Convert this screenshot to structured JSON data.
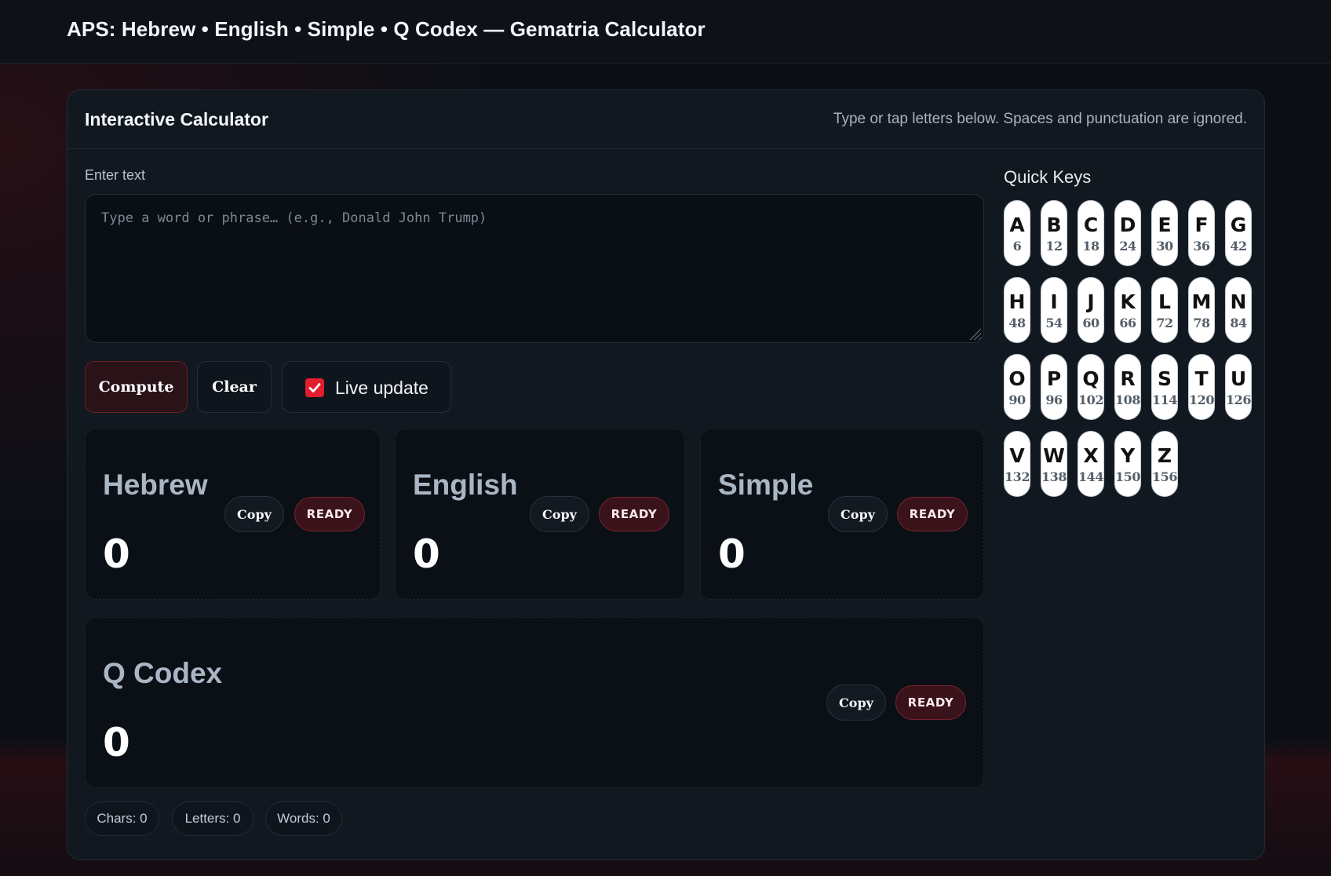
{
  "app": {
    "title": "APS: Hebrew • English • Simple • Q Codex — Gematria Calculator"
  },
  "calculator": {
    "title": "Interactive Calculator",
    "hint": "Type or tap letters below. Spaces and punctuation are ignored.",
    "input_label": "Enter text",
    "input_placeholder": "Type a word or phrase… (e.g., Donald John Trump)",
    "input_value": "",
    "compute_label": "Compute",
    "clear_label": "Clear",
    "live_update_label": "Live update",
    "live_update_checked": true
  },
  "results": {
    "hebrew": {
      "name": "Hebrew",
      "value": "0",
      "copy_label": "Copy",
      "status": "READY"
    },
    "english": {
      "name": "English",
      "value": "0",
      "copy_label": "Copy",
      "status": "READY"
    },
    "simple": {
      "name": "Simple",
      "value": "0",
      "copy_label": "Copy",
      "status": "READY"
    },
    "qcodex": {
      "name": "Q Codex",
      "value": "0",
      "copy_label": "Copy",
      "status": "READY"
    }
  },
  "stats": {
    "chars": "Chars: 0",
    "letters": "Letters: 0",
    "words": "Words: 0"
  },
  "quick_keys": {
    "title": "Quick Keys",
    "keys": [
      {
        "letter": "A",
        "value": "6"
      },
      {
        "letter": "B",
        "value": "12"
      },
      {
        "letter": "C",
        "value": "18"
      },
      {
        "letter": "D",
        "value": "24"
      },
      {
        "letter": "E",
        "value": "30"
      },
      {
        "letter": "F",
        "value": "36"
      },
      {
        "letter": "G",
        "value": "42"
      },
      {
        "letter": "H",
        "value": "48"
      },
      {
        "letter": "I",
        "value": "54"
      },
      {
        "letter": "J",
        "value": "60"
      },
      {
        "letter": "K",
        "value": "66"
      },
      {
        "letter": "L",
        "value": "72"
      },
      {
        "letter": "M",
        "value": "78"
      },
      {
        "letter": "N",
        "value": "84"
      },
      {
        "letter": "O",
        "value": "90"
      },
      {
        "letter": "P",
        "value": "96"
      },
      {
        "letter": "Q",
        "value": "102"
      },
      {
        "letter": "R",
        "value": "108"
      },
      {
        "letter": "S",
        "value": "114"
      },
      {
        "letter": "T",
        "value": "120"
      },
      {
        "letter": "U",
        "value": "126"
      },
      {
        "letter": "V",
        "value": "132"
      },
      {
        "letter": "W",
        "value": "138"
      },
      {
        "letter": "X",
        "value": "144"
      },
      {
        "letter": "Y",
        "value": "150"
      },
      {
        "letter": "Z",
        "value": "156"
      }
    ]
  },
  "colors": {
    "accent": "#e11d2e",
    "badge_bg": "#3a1219",
    "background": "#0b0f15"
  }
}
